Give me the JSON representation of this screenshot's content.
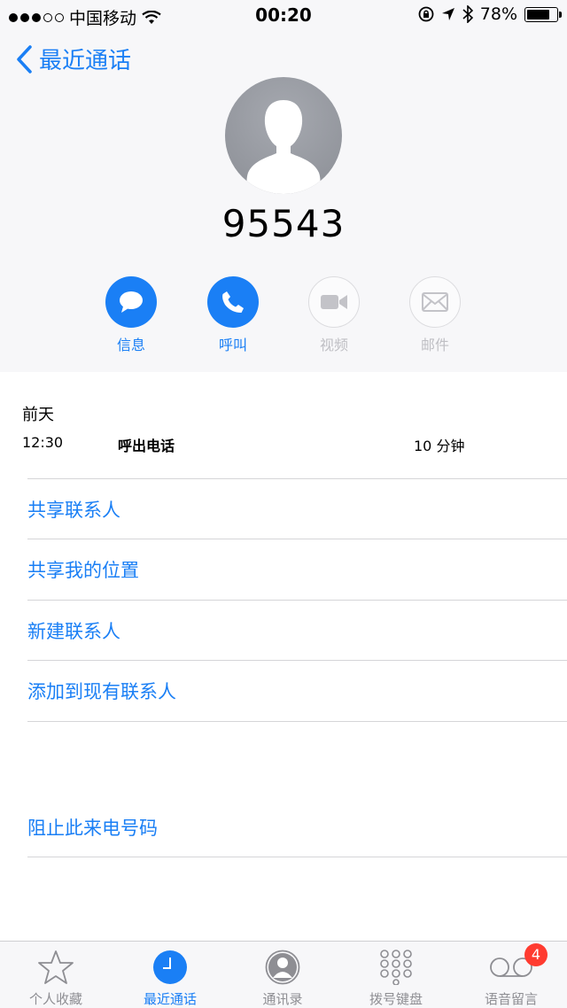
{
  "status_bar": {
    "carrier": "中国移动",
    "time": "00:20",
    "battery_text": "78%",
    "battery_level": 0.78
  },
  "nav": {
    "back_label": "最近通话"
  },
  "contact": {
    "number": "95543"
  },
  "actions": [
    {
      "label": "信息",
      "icon": "message-icon",
      "enabled": true
    },
    {
      "label": "呼叫",
      "icon": "phone-icon",
      "enabled": true
    },
    {
      "label": "视频",
      "icon": "video-icon",
      "enabled": false
    },
    {
      "label": "邮件",
      "icon": "mail-icon",
      "enabled": false
    }
  ],
  "call_history": {
    "day": "前天",
    "time": "12:30",
    "type": "呼出电话",
    "duration": "10 分钟"
  },
  "options": {
    "share_contact": "共享联系人",
    "share_location": "共享我的位置",
    "new_contact": "新建联系人",
    "add_existing": "添加到现有联系人",
    "block": "阻止此来电号码"
  },
  "tabbar": {
    "favorites": "个人收藏",
    "recents": "最近通话",
    "contacts": "通讯录",
    "keypad": "拨号键盘",
    "voicemail": "语音留言",
    "voicemail_badge": "4"
  },
  "colors": {
    "accent": "#1a7ff5",
    "badge": "#ff3b30"
  }
}
